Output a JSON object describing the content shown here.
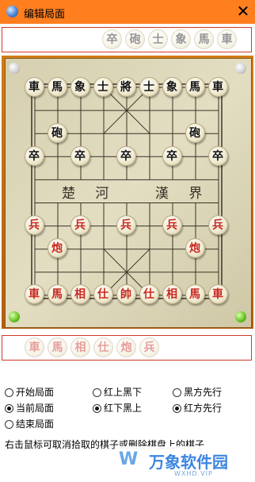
{
  "window": {
    "title": "编辑局面",
    "close_glyph": "✕",
    "icon": "app-globe-icon"
  },
  "top_tray_pieces": [
    "卒",
    "砲",
    "士",
    "象",
    "馬",
    "車"
  ],
  "bottom_tray_pieces": [
    "車",
    "馬",
    "相",
    "仕",
    "炮",
    "兵"
  ],
  "river": {
    "left": "楚 河",
    "right": "漢 界"
  },
  "board": {
    "files": 9,
    "ranks": 10,
    "pieces": [
      {
        "label": "車",
        "side": "black",
        "col": 0,
        "row": 0
      },
      {
        "label": "馬",
        "side": "black",
        "col": 1,
        "row": 0
      },
      {
        "label": "象",
        "side": "black",
        "col": 2,
        "row": 0
      },
      {
        "label": "士",
        "side": "black",
        "col": 3,
        "row": 0
      },
      {
        "label": "將",
        "side": "black",
        "col": 4,
        "row": 0
      },
      {
        "label": "士",
        "side": "black",
        "col": 5,
        "row": 0
      },
      {
        "label": "象",
        "side": "black",
        "col": 6,
        "row": 0
      },
      {
        "label": "馬",
        "side": "black",
        "col": 7,
        "row": 0
      },
      {
        "label": "車",
        "side": "black",
        "col": 8,
        "row": 0
      },
      {
        "label": "砲",
        "side": "black",
        "col": 1,
        "row": 2
      },
      {
        "label": "砲",
        "side": "black",
        "col": 7,
        "row": 2
      },
      {
        "label": "卒",
        "side": "black",
        "col": 0,
        "row": 3
      },
      {
        "label": "卒",
        "side": "black",
        "col": 2,
        "row": 3
      },
      {
        "label": "卒",
        "side": "black",
        "col": 4,
        "row": 3
      },
      {
        "label": "卒",
        "side": "black",
        "col": 6,
        "row": 3
      },
      {
        "label": "卒",
        "side": "black",
        "col": 8,
        "row": 3
      },
      {
        "label": "兵",
        "side": "red",
        "col": 0,
        "row": 6
      },
      {
        "label": "兵",
        "side": "red",
        "col": 2,
        "row": 6
      },
      {
        "label": "兵",
        "side": "red",
        "col": 4,
        "row": 6
      },
      {
        "label": "兵",
        "side": "red",
        "col": 6,
        "row": 6
      },
      {
        "label": "兵",
        "side": "red",
        "col": 8,
        "row": 6
      },
      {
        "label": "炮",
        "side": "red",
        "col": 1,
        "row": 7
      },
      {
        "label": "炮",
        "side": "red",
        "col": 7,
        "row": 7
      },
      {
        "label": "車",
        "side": "red",
        "col": 0,
        "row": 9
      },
      {
        "label": "馬",
        "side": "red",
        "col": 1,
        "row": 9
      },
      {
        "label": "相",
        "side": "red",
        "col": 2,
        "row": 9
      },
      {
        "label": "仕",
        "side": "red",
        "col": 3,
        "row": 9
      },
      {
        "label": "帥",
        "side": "red",
        "col": 4,
        "row": 9
      },
      {
        "label": "仕",
        "side": "red",
        "col": 5,
        "row": 9
      },
      {
        "label": "相",
        "side": "red",
        "col": 6,
        "row": 9
      },
      {
        "label": "馬",
        "side": "red",
        "col": 7,
        "row": 9
      },
      {
        "label": "車",
        "side": "red",
        "col": 8,
        "row": 9
      }
    ]
  },
  "options": {
    "start_position": {
      "label": "开始局面",
      "checked": false
    },
    "current_position": {
      "label": "当前局面",
      "checked": true
    },
    "end_position": {
      "label": "结束局面",
      "checked": false
    },
    "red_top_black_bottom": {
      "label": "红上黑下",
      "checked": false
    },
    "red_bottom_black_top": {
      "label": "红下黑上",
      "checked": true
    },
    "black_first": {
      "label": "黑方先行",
      "checked": false
    },
    "red_first": {
      "label": "红方先行",
      "checked": true
    }
  },
  "hint_text": "右击鼠标可取消拾取的棋子或删除棋盘上的棋子",
  "watermark": {
    "logo": "W",
    "title": "万象软件园",
    "subtitle": "WXHD.VIP"
  },
  "colors": {
    "titlebar": "#ff7f1f",
    "board_frame": "#c06a14",
    "red_piece": "#c7281d",
    "black_piece": "#111111"
  }
}
